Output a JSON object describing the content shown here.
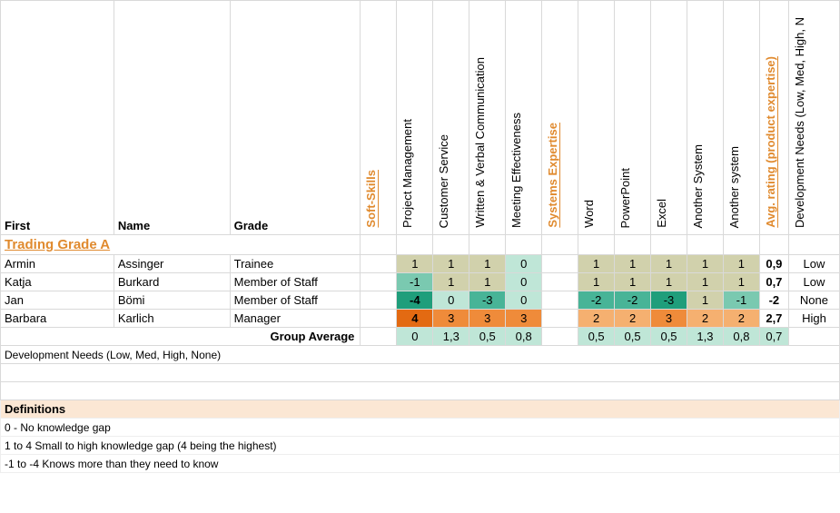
{
  "headers": {
    "first": "First",
    "name": "Name",
    "grade": "Grade",
    "soft_skills": "Soft-Skills",
    "systems_expertise": "Systems Expertise",
    "avg_rating": "Avg. rating (product expertise)",
    "dev_needs_header": "Development Needs (Low, Med, High, N",
    "skill_cols": [
      "Project Management",
      "Customer Service",
      "Written & Verbal Communication",
      "Meeting Effectiveness"
    ],
    "system_cols": [
      "Word",
      "PowerPoint",
      "Excel",
      "Another System",
      "Another system"
    ]
  },
  "section_title": "Trading Grade A",
  "rows": [
    {
      "first": "Armin",
      "name": "Assinger",
      "grade": "Trainee",
      "skills": [
        1,
        1,
        1,
        0
      ],
      "systems": [
        1,
        1,
        1,
        1,
        1
      ],
      "avg": "0,9",
      "dev": "Low"
    },
    {
      "first": "Katja",
      "name": "Burkard",
      "grade": "Member of Staff",
      "skills": [
        -1,
        1,
        1,
        0
      ],
      "systems": [
        1,
        1,
        1,
        1,
        1
      ],
      "avg": "0,7",
      "dev": "Low"
    },
    {
      "first": "Jan",
      "name": "Bömi",
      "grade": "Member of Staff",
      "skills": [
        -4,
        0,
        -3,
        0
      ],
      "systems": [
        -2,
        -2,
        -3,
        1,
        -1
      ],
      "avg": "-2",
      "dev": "None"
    },
    {
      "first": "Barbara",
      "name": "Karlich",
      "grade": "Manager",
      "skills": [
        4,
        3,
        3,
        3
      ],
      "systems": [
        2,
        2,
        3,
        2,
        2
      ],
      "avg": "2,7",
      "dev": "High"
    }
  ],
  "group_average": {
    "label": "Group Average",
    "skills": [
      "0",
      "1,3",
      "0,5",
      "0,8"
    ],
    "systems": [
      "0,5",
      "0,5",
      "0,5",
      "1,3",
      "0,8"
    ],
    "avg": "0,7"
  },
  "dev_needs_row": "Development Needs (Low, Med, High, None)",
  "definitions": {
    "title": "Definitions",
    "lines": [
      "0 - No knowledge gap",
      "1 to 4 Small to high knowledge gap (4 being the highest)",
      "-1 to -4 Knows more than they need to know"
    ]
  },
  "chart_data": {
    "type": "table",
    "title": "Skills gap matrix — Trading Grade A",
    "row_labels": [
      "Armin Assinger (Trainee)",
      "Katja Burkard (Member of Staff)",
      "Jan Bömi (Member of Staff)",
      "Barbara Karlich (Manager)"
    ],
    "columns": [
      "Project Management",
      "Customer Service",
      "Written & Verbal Communication",
      "Meeting Effectiveness",
      "Word",
      "PowerPoint",
      "Excel",
      "Another System",
      "Another system",
      "Avg. rating (product expertise)",
      "Development Needs"
    ],
    "values": [
      [
        1,
        1,
        1,
        0,
        1,
        1,
        1,
        1,
        1,
        0.9,
        "Low"
      ],
      [
        -1,
        1,
        1,
        0,
        1,
        1,
        1,
        1,
        1,
        0.7,
        "Low"
      ],
      [
        -4,
        0,
        -3,
        0,
        -2,
        -2,
        -3,
        1,
        -1,
        -2,
        "None"
      ],
      [
        4,
        3,
        3,
        3,
        2,
        2,
        3,
        2,
        2,
        2.7,
        "High"
      ]
    ],
    "group_average": [
      0,
      1.3,
      0.5,
      0.8,
      0.5,
      0.5,
      0.5,
      1.3,
      0.8,
      0.7
    ]
  }
}
